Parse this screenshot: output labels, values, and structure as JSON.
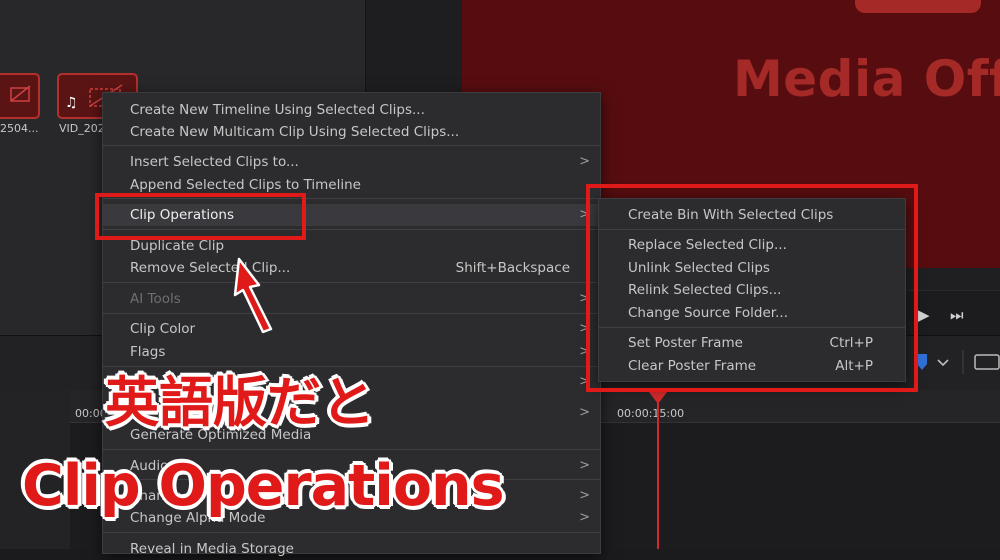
{
  "media_pool": {
    "clips": [
      {
        "name": "2504..."
      },
      {
        "name": "VID_202"
      }
    ]
  },
  "viewer": {
    "offline_text": "Media Off"
  },
  "timeline": {
    "ruler_left_timecode": "00:00",
    "ruler_timecode": "00:00:15:00"
  },
  "context_menu": {
    "items": [
      {
        "label": "Create New Timeline Using Selected Clips..."
      },
      {
        "label": "Create New Multicam Clip Using Selected Clips..."
      },
      {
        "label": "Insert Selected Clips to...",
        "submenu": true
      },
      {
        "label": "Append Selected Clips to Timeline"
      },
      {
        "label": "Clip Operations",
        "submenu": true,
        "highlighted": true
      },
      {
        "label": "Duplicate Clip"
      },
      {
        "label": "Remove Selected Clip...",
        "shortcut": "Shift+Backspace"
      },
      {
        "label": "AI Tools",
        "disabled": true,
        "submenu": true
      },
      {
        "label": "Clip Color",
        "submenu": true
      },
      {
        "label": "Flags",
        "submenu": true
      },
      {
        "label": "",
        "submenu": true
      },
      {
        "label": "",
        "submenu": true
      },
      {
        "label": "Generate Optimized Media"
      },
      {
        "label": "Audio",
        "submenu": true
      },
      {
        "label": "Change",
        "submenu": true
      },
      {
        "label": "Change Alpha Mode",
        "submenu": true
      },
      {
        "label": "Reveal in Media Storage"
      }
    ],
    "arrow_glyph": ">"
  },
  "submenu": {
    "items": [
      {
        "label": "Create Bin With Selected Clips"
      },
      {
        "label": "Replace Selected Clip..."
      },
      {
        "label": "Unlink Selected Clips"
      },
      {
        "label": "Relink Selected Clips..."
      },
      {
        "label": "Change Source Folder..."
      },
      {
        "label": "Set Poster Frame",
        "shortcut": "Ctrl+P"
      },
      {
        "label": "Clear Poster Frame",
        "shortcut": "Alt+P"
      }
    ]
  },
  "annotation": {
    "japanese": "英語版だと",
    "english": "Clip Operations",
    "color": "#e01919"
  },
  "icons": {
    "music_note": "♫",
    "play": "▶",
    "skip_forward": "⏭"
  },
  "colors": {
    "viewer_bg": "#570d0f",
    "offline_text": "#a52a27",
    "playhead": "#d02a2a",
    "menu_bg": "#2c2c2f"
  }
}
